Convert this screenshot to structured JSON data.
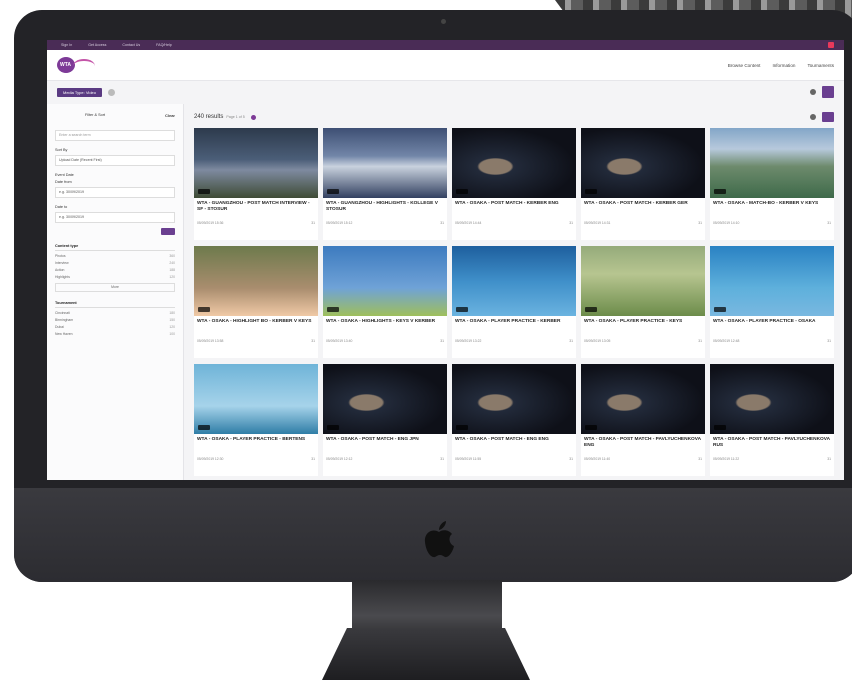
{
  "topbar": {
    "links": [
      "Sign In",
      "Get Access",
      "Contact Us",
      "FAQ/Help"
    ]
  },
  "header": {
    "logo_text": "WTA",
    "nav": [
      "Browse Content",
      "Information",
      "Tournaments"
    ]
  },
  "search": {
    "media_type_button": "Media Type: Video"
  },
  "sidebar": {
    "filter_label": "Filter & Sort",
    "clear_label": "Clear",
    "search_placeholder": "Enter a search term",
    "sort_by_label": "Sort By",
    "sort_by_value": "Upload Date (Recent First)",
    "event_date_label": "Event Date",
    "date_from_label": "Date from",
    "date_from_value": "e.g. 30/09/2019",
    "date_to_label": "Date to",
    "date_to_value": "e.g. 30/09/2019",
    "content_type": {
      "title": "Content type",
      "rows": [
        {
          "label": "Photos",
          "count": "360"
        },
        {
          "label": "Interview",
          "count": "240"
        },
        {
          "label": "Action",
          "count": "188"
        },
        {
          "label": "Highlights",
          "count": "120"
        }
      ]
    },
    "more_label": "More",
    "tournament": {
      "title": "Tournament",
      "rows": [
        {
          "label": "Cincinnati",
          "count": "180"
        },
        {
          "label": "Birmingham",
          "count": "150"
        },
        {
          "label": "Dubai",
          "count": "120"
        },
        {
          "label": "New Haven",
          "count": "100"
        }
      ]
    }
  },
  "results": {
    "title": "240 results",
    "page": "Page 1 of 5"
  },
  "cards": [
    {
      "title": "WTA - GUANGZHOU - POST MATCH INTERVIEW - SF - STOSUR",
      "date": "05/09/2019 15:36",
      "count": "31",
      "thumb": "t-stadium"
    },
    {
      "title": "WTA - GUANGZHOU - HIGHLIGHTS - KOLLEGE V STOSUR",
      "date": "05/09/2019 15:12",
      "count": "31",
      "thumb": "t-crowd"
    },
    {
      "title": "WTA - OSAKA - POST MATCH - KERBER ENG",
      "date": "05/09/2019 14:44",
      "count": "31",
      "thumb": "t-dark"
    },
    {
      "title": "WTA - OSAKA - POST MATCH - KERBER GER",
      "date": "05/09/2019 14:31",
      "count": "31",
      "thumb": "t-dark"
    },
    {
      "title": "WTA - OSAKA - MATCH-BO - KERBER V KEYS",
      "date": "05/09/2019 14:10",
      "count": "31",
      "thumb": "t-court"
    },
    {
      "title": "WTA - OSAKA - HIGHLIGHT BO - KERBER V KEYS",
      "date": "05/09/2019 13:58",
      "count": "31",
      "thumb": "t-face"
    },
    {
      "title": "WTA - OSAKA - HIGHLIGHTS - KEYS V KERBER",
      "date": "05/09/2019 13:40",
      "count": "31",
      "thumb": "t-blue"
    },
    {
      "title": "WTA - OSAKA - PLAYER PRACTICE - KERBER",
      "date": "05/09/2019 13:22",
      "count": "31",
      "thumb": "t-tennis"
    },
    {
      "title": "WTA - OSAKA - PLAYER PRACTICE - KEYS",
      "date": "05/09/2019 13:05",
      "count": "31",
      "thumb": "t-green"
    },
    {
      "title": "WTA - OSAKA - PLAYER PRACTICE - OSAKA",
      "date": "05/09/2019 12:48",
      "count": "31",
      "thumb": "t-sky"
    },
    {
      "title": "WTA - OSAKA - PLAYER PRACTICE - BERTENS",
      "date": "05/09/2019 12:30",
      "count": "31",
      "thumb": "t-logo"
    },
    {
      "title": "WTA - OSAKA - POST MATCH - ENG JPN",
      "date": "05/09/2019 12:12",
      "count": "31",
      "thumb": "t-dark"
    },
    {
      "title": "WTA - OSAKA - POST MATCH - ENG ENG",
      "date": "05/09/2019 11:55",
      "count": "31",
      "thumb": "t-dark"
    },
    {
      "title": "WTA - OSAKA - POST MATCH - PAVLYUCHENKOVA ENG",
      "date": "05/09/2019 11:40",
      "count": "31",
      "thumb": "t-dark"
    },
    {
      "title": "WTA - OSAKA - POST MATCH - PAVLYUCHENKOVA RUS",
      "date": "05/09/2019 11:22",
      "count": "31",
      "thumb": "t-dark"
    }
  ]
}
